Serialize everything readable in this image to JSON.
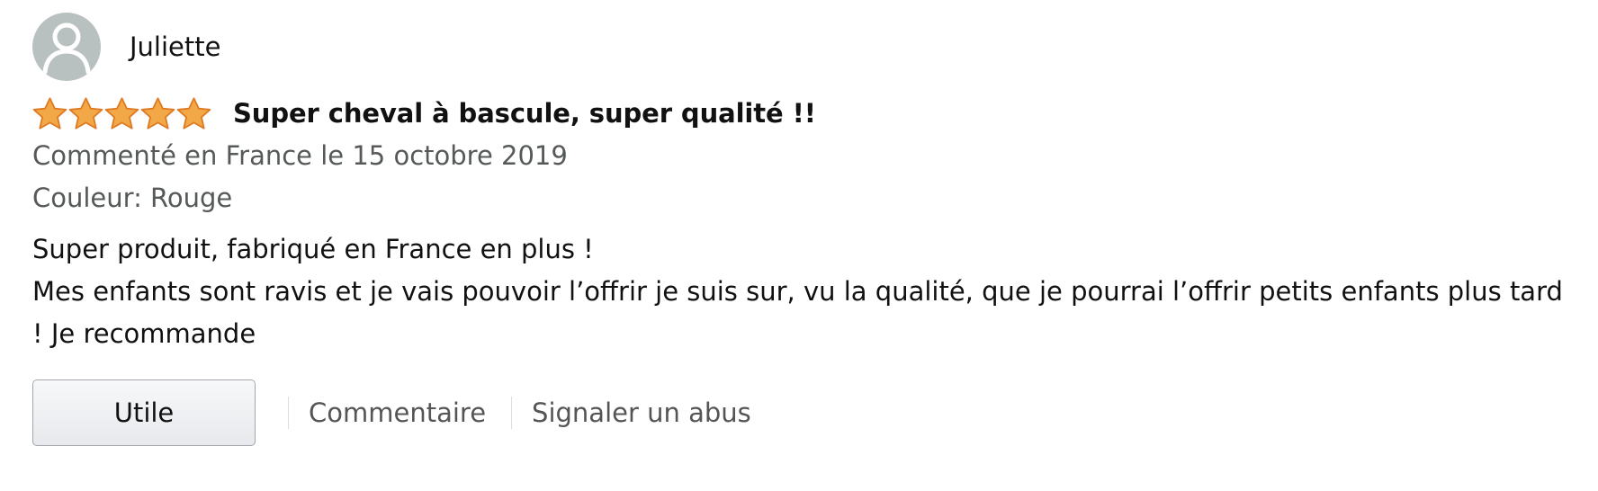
{
  "review": {
    "author": "Juliette",
    "avatar_icon": "user-silhouette-icon",
    "rating": 5,
    "rating_max": 5,
    "star_color": "#f3a847",
    "title": "Super cheval à bascule, super qualité !!",
    "reviewed_in": "Commenté en France le 15 octobre 2019",
    "variant": "Couleur: Rouge",
    "body_lines": [
      "Super produit, fabriqué en France en plus !",
      "Mes enfants sont ravis et je vais pouvoir l’offrir je suis sur, vu la qualité, que je pourrai l’offrir petits enfants plus tard",
      "! Je recommande"
    ]
  },
  "actions": {
    "helpful_label": "Utile",
    "comment_label": "Commentaire",
    "report_label": "Signaler un abus"
  }
}
